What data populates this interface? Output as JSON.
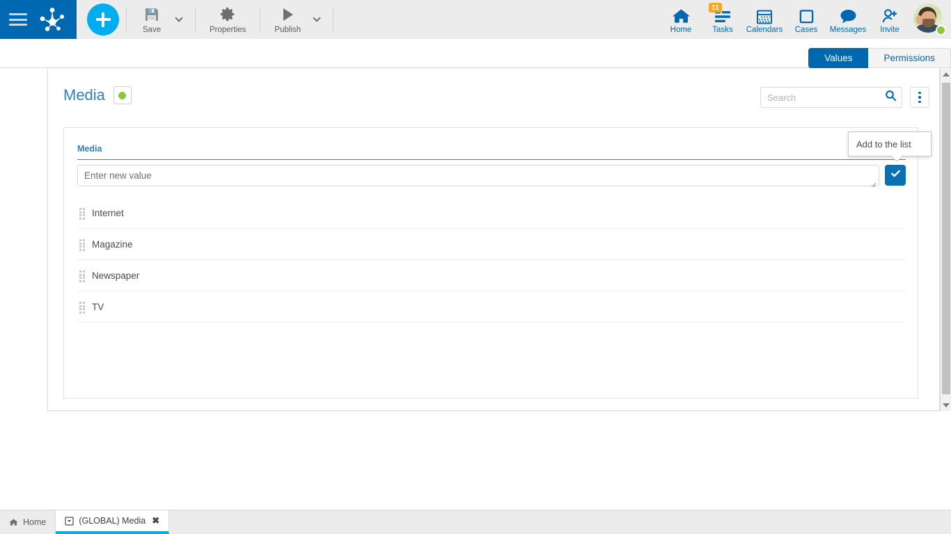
{
  "topbar": {
    "menu_icon": "hamburger-icon",
    "logo_icon": "app-logo-icon",
    "add_button_label": "+",
    "tools": [
      {
        "icon": "save-icon",
        "label": "Save",
        "has_caret": true
      },
      {
        "icon": "gear-icon",
        "label": "Properties",
        "has_caret": false
      },
      {
        "icon": "play-icon",
        "label": "Publish",
        "has_caret": true
      }
    ],
    "nav": [
      {
        "icon": "home-icon",
        "label": "Home",
        "badge": ""
      },
      {
        "icon": "tasks-icon",
        "label": "Tasks",
        "badge": "11"
      },
      {
        "icon": "calendar-icon",
        "label": "Calendars",
        "badge": ""
      },
      {
        "icon": "cases-icon",
        "label": "Cases",
        "badge": ""
      },
      {
        "icon": "messages-icon",
        "label": "Messages",
        "badge": ""
      },
      {
        "icon": "invite-icon",
        "label": "Invite",
        "badge": ""
      }
    ],
    "avatar": {
      "name": "avatar",
      "status": "online"
    }
  },
  "tabs": {
    "values_label": "Values",
    "permissions_label": "Permissions",
    "active": "Values"
  },
  "panel": {
    "title": "Media",
    "status_indicator": "active",
    "search": {
      "value": "",
      "placeholder": "Search"
    },
    "search_button_icon": "search-icon",
    "overflow_menu_icon": "kebab-menu-icon"
  },
  "card": {
    "label": "Media",
    "new_value": {
      "value": "",
      "placeholder": "Enter new value"
    },
    "confirm_button_icon": "check-icon",
    "items": [
      {
        "label": "Internet"
      },
      {
        "label": "Magazine"
      },
      {
        "label": "Newspaper"
      },
      {
        "label": "TV"
      }
    ]
  },
  "tooltip": {
    "text": "Add to the list"
  },
  "taskbar": {
    "items": [
      {
        "icon": "home-icon",
        "label": "Home",
        "active": false,
        "closable": false
      },
      {
        "icon": "window-icon",
        "label": "(GLOBAL) Media",
        "active": true,
        "closable": true,
        "close_glyph": "✖"
      }
    ]
  },
  "colors": {
    "brand_blue": "#0067b1",
    "accent_cyan": "#00adef",
    "status_green": "#8dc63f",
    "badge_orange": "#f5a623",
    "title_blue": "#2f7fc1"
  }
}
